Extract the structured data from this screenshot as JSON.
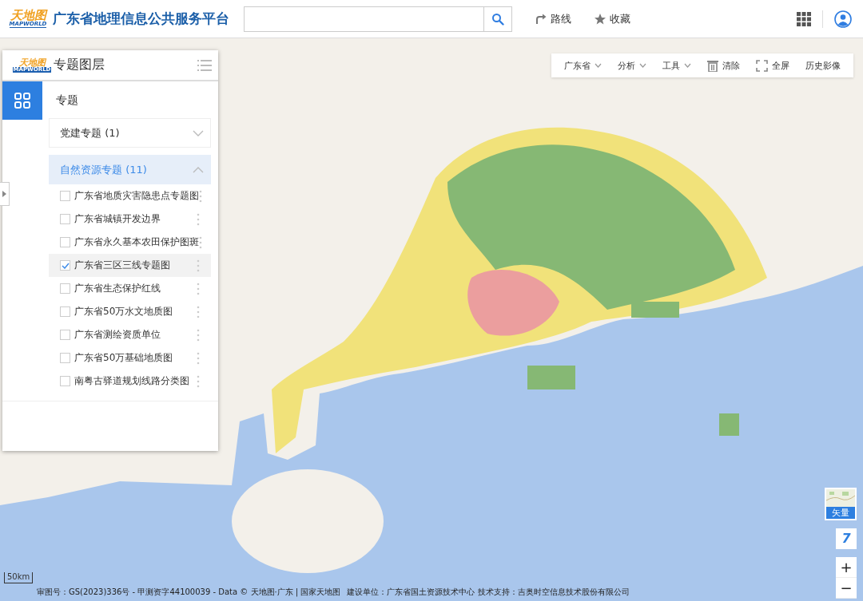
{
  "header": {
    "logo": {
      "text": "天地图",
      "sub": "MAPWORLD"
    },
    "title": "广东省地理信息公共服务平台",
    "nav": [
      {
        "kind": "route",
        "label": "路线"
      },
      {
        "kind": "star",
        "label": "收藏"
      }
    ]
  },
  "panel": {
    "logo": {
      "text": "天地图",
      "sub": "MAPWORLD"
    },
    "title": "专题图层",
    "tab": {
      "label": "专题",
      "selected": true
    },
    "groups": [
      {
        "label": "党建专题 (1)",
        "expanded": false
      },
      {
        "label": "自然资源专题 (11)",
        "expanded": true,
        "items": [
          {
            "label": "广东省地质灾害隐患点专题图",
            "checked": false,
            "selected": false
          },
          {
            "label": "广东省城镇开发边界",
            "checked": false,
            "selected": false
          },
          {
            "label": "广东省永久基本农田保护图斑",
            "checked": false,
            "selected": false
          },
          {
            "label": "广东省三区三线专题图",
            "checked": true,
            "selected": true
          },
          {
            "label": "广东省生态保护红线",
            "checked": false,
            "selected": false
          },
          {
            "label": "广东省50万水文地质图",
            "checked": false,
            "selected": false
          },
          {
            "label": "广东省测绘资质单位",
            "checked": false,
            "selected": false
          },
          {
            "label": "广东省50万基础地质图",
            "checked": false,
            "selected": false
          },
          {
            "label": "南粤古驿道规划线路分类图",
            "checked": false,
            "selected": false
          }
        ]
      }
    ]
  },
  "toolbar": [
    {
      "kind": "dropdown",
      "label": "广东省"
    },
    {
      "kind": "dropdown",
      "label": "分析"
    },
    {
      "kind": "dropdown",
      "label": "工具"
    },
    {
      "kind": "trash",
      "label": "清除"
    },
    {
      "kind": "fullscreen",
      "label": "全屏"
    },
    {
      "kind": "plain",
      "label": "历史影像"
    }
  ],
  "basemap": {
    "label": "矢量"
  },
  "zoom": {
    "level": "7",
    "in": "+",
    "out": "−"
  },
  "scale": "50km",
  "attribution": [
    "审图号：GS(2023)336号 - 甲测资字44100039 - Data © 天地图·广东 | 国家天地图",
    "建设单位：广东省国土资源技术中心 技术支持：吉奥时空信息技术股份有限公司"
  ]
}
